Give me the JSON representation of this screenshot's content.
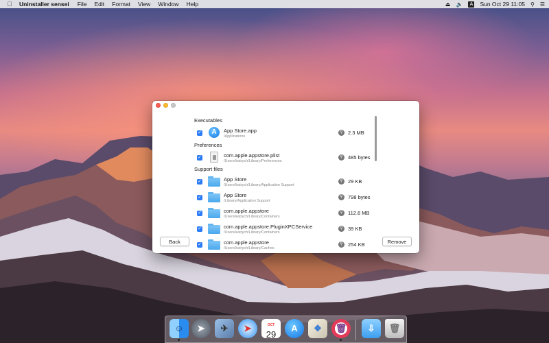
{
  "menubar": {
    "app_name": "Uninstaller sensei",
    "menus": [
      "File",
      "Edit",
      "Format",
      "View",
      "Window",
      "Help"
    ],
    "clock": "Sun Oct 29  11:05",
    "input_source": "A"
  },
  "window": {
    "sections": {
      "executables": "Executables",
      "preferences": "Preferences",
      "support_files": "Support files"
    },
    "files": [
      {
        "name": "App Store.app",
        "path": "/Applications",
        "size": "2.3 MB"
      },
      {
        "name": "com.apple.appstore.plist",
        "path": "/Users/katrych/Library/Preferences",
        "size": "485 bytes"
      },
      {
        "name": "App Store",
        "path": "/Users/katrych/Library/Application Support",
        "size": "29 KB"
      },
      {
        "name": "App Store",
        "path": "/Library/Application Support",
        "size": "798 bytes"
      },
      {
        "name": "com.apple.appstore",
        "path": "/Users/katrych/Library/Containers",
        "size": "112.6 MB"
      },
      {
        "name": "com.apple.appstore.PluginXPCService",
        "path": "/Users/katrych/Library/Containers",
        "size": "39 KB"
      },
      {
        "name": "com.apple.appstore",
        "path": "/Users/katrych/Library/Caches",
        "size": "254 KB"
      }
    ],
    "buttons": {
      "back": "Back",
      "remove": "Remove"
    }
  },
  "dock": {
    "calendar_month": "OCT",
    "calendar_day": "29"
  },
  "colors": {
    "checkbox_blue": "#2d7cf6",
    "folder_blue": "#4aa8ec",
    "close": "#fc5f57",
    "minimize": "#fdbc2e"
  }
}
